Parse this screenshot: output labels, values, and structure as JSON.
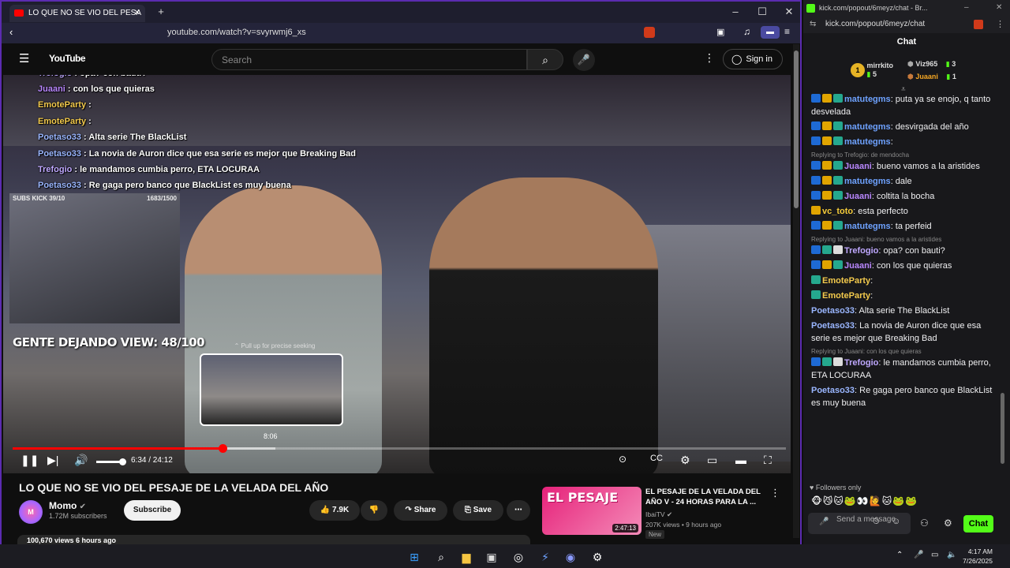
{
  "browser": {
    "tab_title": "LO QUE NO SE VIO DEL PESA",
    "url": "youtube.com/watch?v=svyrwmj6_xs"
  },
  "youtube": {
    "logo": "YouTube",
    "search_placeholder": "Search",
    "sign_in": "Sign in"
  },
  "overlay": {
    "webcam_left": "SUBS KICK 39/10",
    "webcam_right": "1683/1500",
    "gente": "GENTE DEJANDO VIEW: 48/100",
    "chat": [
      {
        "user": "matutegms",
        "text": ": dale",
        "color": "#6ea2ff"
      },
      {
        "user": "Juaani",
        "text": ": coltita la bocha",
        "color": "#b987ff"
      },
      {
        "user": "vc_toto",
        "text": ": esta perfecto",
        "color": "#f5cc3a"
      },
      {
        "user": "matutegms",
        "text": ": ta perfeid",
        "color": "#6ea2ff"
      },
      {
        "user": "Trefogio",
        "text": ": opa? con bauti?",
        "color": "#bfa8ff"
      },
      {
        "user": "Juaani",
        "text": ": con los que quieras",
        "color": "#b987ff"
      },
      {
        "user": "EmoteParty",
        "text": ":",
        "color": "#f2c94c"
      },
      {
        "user": "EmoteParty",
        "text": ":",
        "color": "#f2c94c"
      },
      {
        "user": "Poetaso33",
        "text": ": Alta serie The BlackList",
        "color": "#9ab6ff"
      },
      {
        "user": "Poetaso33",
        "text": ": La novia de Auron dice que esa serie es mejor que Breaking Bad",
        "color": "#9ab6ff"
      },
      {
        "user": "Trefogio",
        "text": ": le mandamos cumbia perro, ETA LOCURAA",
        "color": "#bfa8ff"
      },
      {
        "user": "Poetaso33",
        "text": ": Re gaga pero banco que BlackList es muy buena",
        "color": "#9ab6ff"
      }
    ]
  },
  "player": {
    "pull_up": "Pull up for precise seeking",
    "preview_time": "8:06",
    "time": "6:34 / 24:12",
    "progress_fraction": 0.271,
    "buffer_fraction": 0.34
  },
  "video": {
    "title": "LO QUE NO SE VIO DEL PESAJE DE LA VELADA DEL AÑO",
    "channel": "Momo",
    "subscribers": "1.72M subscribers",
    "subscribe": "Subscribe",
    "likes": "7.9K",
    "share": "Share",
    "save": "Save",
    "views": "100,670 views  6 hours ago"
  },
  "recommended": {
    "thumb_text": "EL PESAJE",
    "duration": "2:47:13",
    "title": "EL PESAJE DE LA VELADA DEL AÑO V - 24 HORAS PARA LA ...",
    "channel": "IbaiTV",
    "meta": "207K views • 9 hours ago",
    "badge": "New"
  },
  "kick": {
    "tab_title": "kick.com/popout/6meyz/chat - Br...",
    "url": "kick.com/popout/6meyz/chat",
    "header": "Chat",
    "top": [
      {
        "rank": "1",
        "user": "mirrkito",
        "count": "5"
      },
      {
        "user": "Viz965",
        "count": "3"
      },
      {
        "user": "Juaani",
        "count": "1"
      }
    ],
    "messages": [
      {
        "reply": "",
        "user": "matutegms",
        "text": ": puta ya se enojo, q tanto desvelada",
        "cls": "u1"
      },
      {
        "reply": "",
        "user": "matutegms",
        "text": ": desvirgada del año",
        "cls": "u1"
      },
      {
        "reply": "",
        "user": "matutegms",
        "text": ":",
        "cls": "u1"
      },
      {
        "reply": "Replying to Trefogio: de mendocha",
        "user": "Juaani",
        "text": ": bueno vamos a la aristides",
        "cls": "u2"
      },
      {
        "reply": "",
        "user": "matutegms",
        "text": ": dale",
        "cls": "u1"
      },
      {
        "reply": "",
        "user": "Juaani",
        "text": ": coltita la bocha",
        "cls": "u2"
      },
      {
        "reply": "",
        "user": "vc_toto",
        "text": ": esta perfecto",
        "cls": "u4"
      },
      {
        "reply": "",
        "user": "matutegms",
        "text": ": ta perfeid",
        "cls": "u1"
      },
      {
        "reply": "Replying to Juaani: bueno vamos a la aristides",
        "user": "Trefogio",
        "text": ": opa? con bauti?",
        "cls": "u3"
      },
      {
        "reply": "",
        "user": "Juaani",
        "text": ": con los que quieras",
        "cls": "u2"
      },
      {
        "reply": "",
        "user": "EmoteParty",
        "text": ":",
        "cls": "u5"
      },
      {
        "reply": "",
        "user": "EmoteParty",
        "text": ":",
        "cls": "u5"
      },
      {
        "reply": "",
        "user": "Poetaso33",
        "text": ": Alta serie The BlackList",
        "cls": "u6"
      },
      {
        "reply": "",
        "user": "Poetaso33",
        "text": ": La novia de Auron dice que esa serie es mejor que Breaking Bad",
        "cls": "u6"
      },
      {
        "reply": "Replying to Juaani: con los que quieras",
        "user": "Trefogio",
        "text": ": le mandamos cumbia perro, ETA LOCURAA",
        "cls": "u3"
      },
      {
        "reply": "",
        "user": "Poetaso33",
        "text": ": Re gaga pero banco que BlackList es muy buena",
        "cls": "u6"
      }
    ],
    "followers_only": "Followers only",
    "send_placeholder": "Send a message",
    "chat_button": "Chat"
  },
  "taskbar": {
    "time": "4:17 AM",
    "date": "7/26/2025"
  },
  "colors": {
    "accent_red": "#ff0000",
    "kick_green": "#53fc18",
    "frame_purple": "#5b2bb0"
  }
}
